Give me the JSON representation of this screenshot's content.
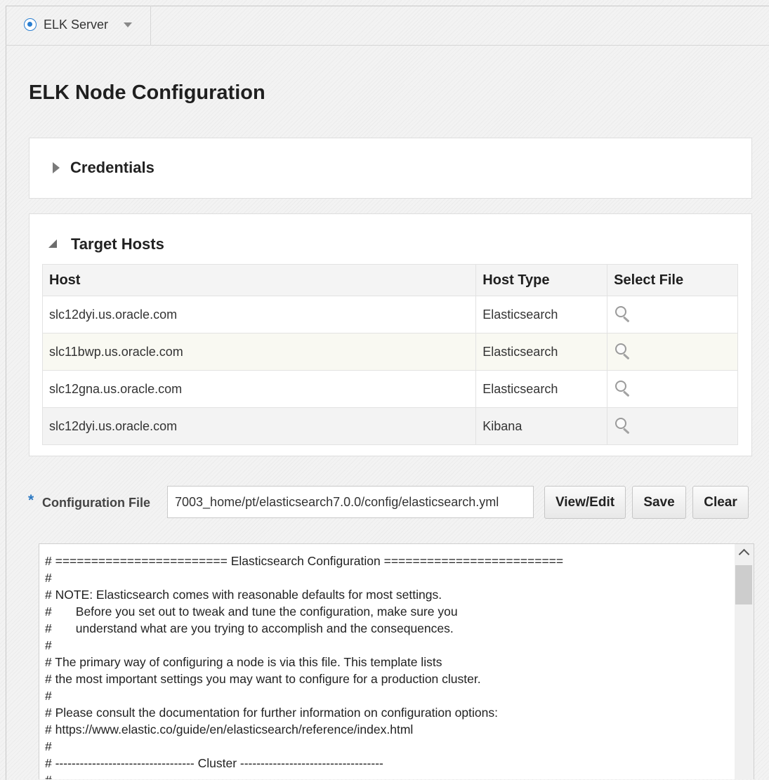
{
  "server_select": {
    "label": "ELK Server"
  },
  "page_title": "ELK Node Configuration",
  "credentials": {
    "title": "Credentials"
  },
  "target_hosts": {
    "title": "Target Hosts",
    "columns": [
      "Host",
      "Host Type",
      "Select File"
    ],
    "rows": [
      {
        "host": "slc12dyi.us.oracle.com",
        "type": "Elasticsearch"
      },
      {
        "host": "slc11bwp.us.oracle.com",
        "type": "Elasticsearch"
      },
      {
        "host": "slc12gna.us.oracle.com",
        "type": "Elasticsearch"
      },
      {
        "host": "slc12dyi.us.oracle.com",
        "type": "Kibana"
      }
    ]
  },
  "config": {
    "required_marker": "*",
    "label": "Configuration File",
    "value": "7003_home/pt/elasticsearch7.0.0/config/elasticsearch.yml",
    "buttons": {
      "view_edit": "View/Edit",
      "save": "Save",
      "clear": "Clear"
    }
  },
  "file_content": [
    "# ======================== Elasticsearch Configuration =========================",
    "#",
    "# NOTE: Elasticsearch comes with reasonable defaults for most settings.",
    "#       Before you set out to tweak and tune the configuration, make sure you",
    "#       understand what are you trying to accomplish and the consequences.",
    "#",
    "# The primary way of configuring a node is via this file. This template lists",
    "# the most important settings you may want to configure for a production cluster.",
    "#",
    "# Please consult the documentation for further information on configuration options:",
    "# https://www.elastic.co/guide/en/elasticsearch/reference/index.html",
    "#",
    "# ---------------------------------- Cluster -----------------------------------",
    "#"
  ]
}
